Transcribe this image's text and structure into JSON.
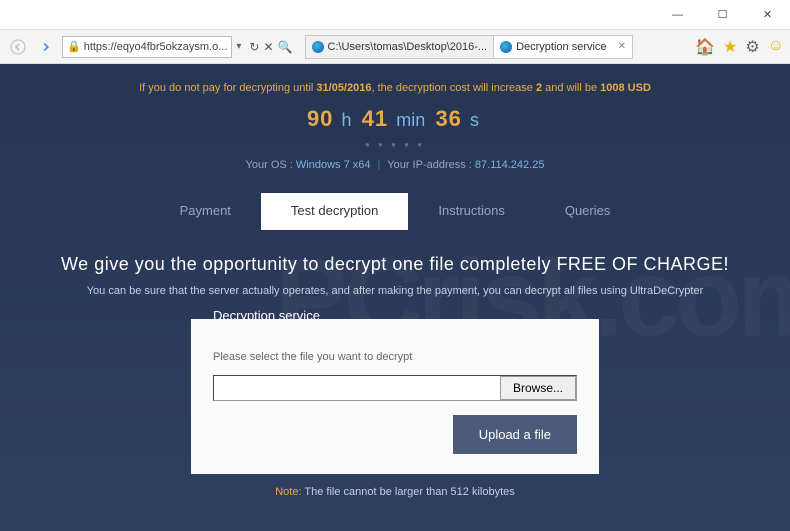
{
  "window": {
    "min": "—",
    "max": "☐",
    "close": "✕"
  },
  "toolbar": {
    "url": "https://eqyo4fbr5okzaysm.o...",
    "tabs": [
      {
        "label": "C:\\Users\\tomas\\Desktop\\2016-..."
      },
      {
        "label": "Decryption service"
      }
    ]
  },
  "warning": {
    "prefix": "If you do not pay for decrypting until ",
    "deadline": "31/05/2016",
    "mid": ", the decryption cost will increase ",
    "factor": "2",
    "mid2": " and will be ",
    "amount": "1008 USD"
  },
  "countdown": {
    "h": "90",
    "hl": "h",
    "m": "41",
    "ml": "min",
    "s": "36",
    "sl": "s"
  },
  "sys": {
    "os_label": "Your OS : ",
    "os": "Windows 7 x64",
    "ip_label": "Your IP-address : ",
    "ip": "87.114.242.25"
  },
  "nav": {
    "payment": "Payment",
    "test": "Test decryption",
    "instructions": "Instructions",
    "queries": "Queries"
  },
  "hero": {
    "title": "We give you the opportunity to decrypt one file completely FREE OF CHARGE!",
    "sub": "You can be sure that the server actually operates, and after making the payment, you can decrypt all files using UltraDeCrypter"
  },
  "panel": {
    "legend": "Decryption service",
    "hint": "Please select the file you want to decrypt",
    "browse": "Browse...",
    "upload": "Upload a file"
  },
  "note": {
    "label": "Note:",
    "text": " The file cannot be larger than 512 kilobytes"
  }
}
